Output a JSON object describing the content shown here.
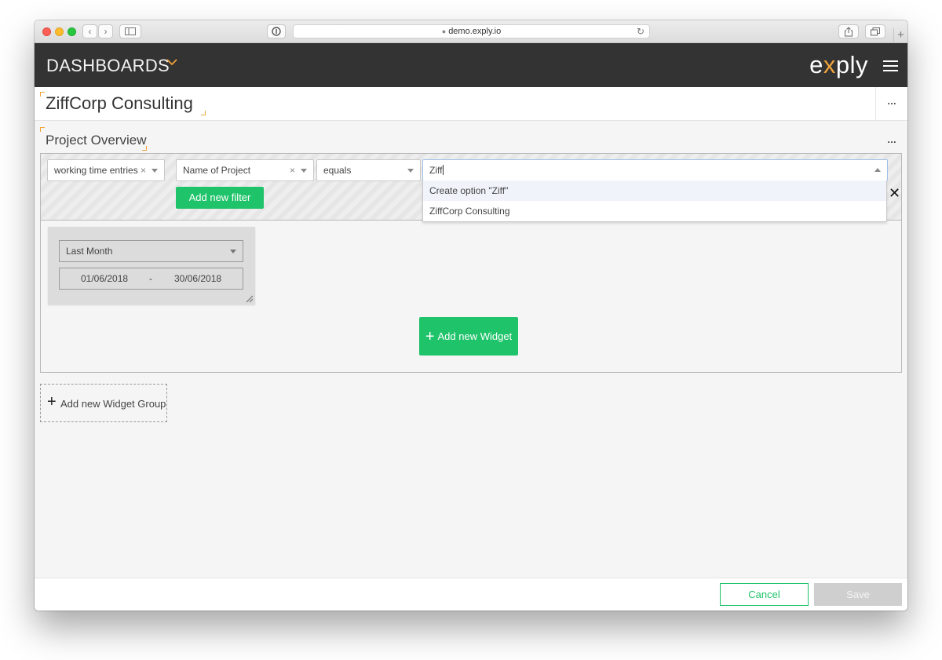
{
  "browser": {
    "url": "demo.exply.io"
  },
  "header": {
    "title": "DASHBOARDS",
    "logo_prefix": "e",
    "logo_x": "x",
    "logo_suffix": "ply",
    "accent_color": "#f2a43a",
    "background_color": "#333333"
  },
  "dashboard": {
    "name": "ZiffCorp Consulting",
    "menu_label": "...",
    "group": {
      "title": "Project Overview",
      "menu_label": "...",
      "filter": {
        "source": "working time entries",
        "field": "Name of Project",
        "operator": "equals",
        "value": "Ziff",
        "clear_glyph": "×",
        "remove_glyph": "✕",
        "add_filter_label": "Add new filter",
        "options": [
          {
            "label": "Create option \"Ziff\""
          },
          {
            "label": "ZiffCorp Consulting"
          }
        ]
      },
      "date_widget": {
        "range_preset": "Last Month",
        "start_date": "01/06/2018",
        "separator": "-",
        "end_date": "30/06/2018"
      },
      "add_widget_label": "Add new Widget"
    },
    "add_group_label": "Add new Widget Group"
  },
  "footer": {
    "cancel_label": "Cancel",
    "save_label": "Save"
  },
  "colors": {
    "primary_green": "#1fc36a",
    "disabled_gray": "#cfcfcf"
  }
}
